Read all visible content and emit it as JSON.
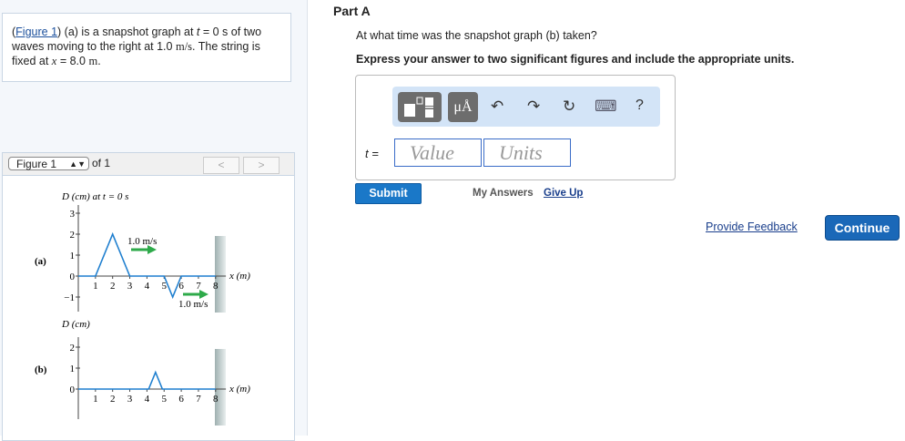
{
  "intro": {
    "figure_link": "Figure 1",
    "text_a": ") (a) is a snapshot graph at ",
    "t_var": "t",
    "text_b": " = 0 s of two waves moving to the right at 1.0 ",
    "unit_ms": "m/s",
    "text_c": ". The string is fixed at ",
    "x_var": "x",
    "text_d": " = 8.0 ",
    "unit_m": "m",
    "text_e": "."
  },
  "figure_nav": {
    "selected": "Figure 1",
    "of_label": "of 1",
    "prev": "<",
    "next": ">"
  },
  "figure": {
    "a": {
      "panel_label": "(a)",
      "y_label": "D (cm) at t = 0 s",
      "x_label": "x (m)",
      "y_ticks": [
        "3",
        "2",
        "1",
        "0",
        "−1"
      ],
      "x_ticks": [
        "1",
        "2",
        "3",
        "4",
        "5",
        "6",
        "7",
        "8"
      ],
      "speed_label_1": "1.0 m/s",
      "speed_label_2": "1.0 m/s",
      "points": [
        [
          0,
          0
        ],
        [
          1,
          0
        ],
        [
          2,
          2
        ],
        [
          3,
          0
        ],
        [
          5,
          0
        ],
        [
          5.5,
          -1
        ],
        [
          6,
          0
        ],
        [
          8,
          0
        ]
      ]
    },
    "b": {
      "panel_label": "(b)",
      "y_label": "D (cm)",
      "x_label": "x (m)",
      "y_ticks": [
        "2",
        "1",
        "0"
      ],
      "x_ticks": [
        "1",
        "2",
        "3",
        "4",
        "5",
        "6",
        "7",
        "8"
      ],
      "points": [
        [
          0,
          0
        ],
        [
          4.1,
          0
        ],
        [
          4.5,
          0.8
        ],
        [
          4.9,
          0
        ],
        [
          8,
          0
        ]
      ]
    },
    "line_color": "#1f7fcf",
    "arrow_color": "#2eaa4a"
  },
  "part": {
    "title": "Part A",
    "question": "At what time was the snapshot graph (b) taken?",
    "instruction": "Express your answer to two significant figures and include the appropriate units.",
    "toolbar": {
      "units_btn": "μÅ",
      "undo": "↶",
      "redo": "↷",
      "reset": "↻",
      "keyboard": "⌨",
      "help": "?"
    },
    "var_label": "t =",
    "value_placeholder": "Value",
    "units_placeholder": "Units",
    "submit": "Submit",
    "my_answers": "My Answers",
    "give_up": "Give Up"
  },
  "footer": {
    "feedback": "Provide Feedback",
    "continue": "Continue"
  }
}
